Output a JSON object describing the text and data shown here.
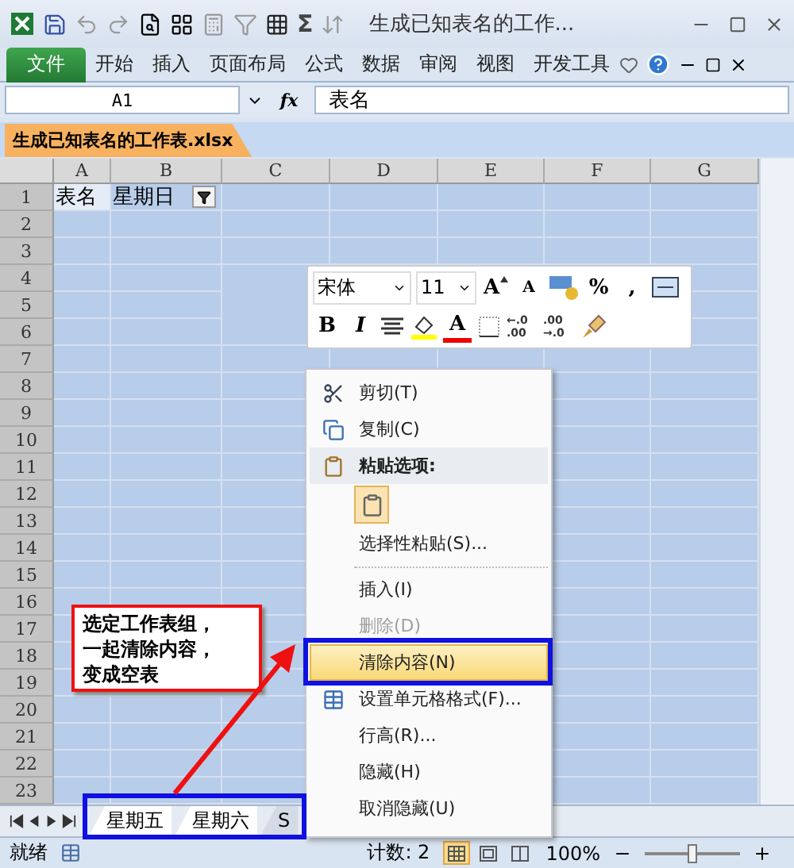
{
  "title_bar": {
    "title": "生成已知表名的工作...",
    "quick_access": [
      {
        "kind": "save"
      },
      {
        "kind": "undo"
      },
      {
        "kind": "redo"
      },
      {
        "kind": "preview"
      },
      {
        "kind": "layout"
      },
      {
        "kind": "calc"
      },
      {
        "kind": "filter"
      },
      {
        "kind": "grid"
      },
      {
        "kind": "text",
        "text": "Σ"
      },
      {
        "kind": "sort"
      }
    ]
  },
  "ribbon": {
    "file": "文件",
    "tabs": [
      "开始",
      "插入",
      "页面布局",
      "公式",
      "数据",
      "审阅",
      "视图",
      "开发工具"
    ]
  },
  "formula_bar": {
    "name_box": "A1",
    "fx": "fx",
    "formula": "表名"
  },
  "workbook_tab": "生成已知表名的工作表.xlsx",
  "columns": [
    "A",
    "B",
    "C",
    "D",
    "E",
    "F",
    "G"
  ],
  "rows": [
    {
      "label": "1",
      "cells": [
        {
          "text": "表名",
          "active": true,
          "filter": false
        },
        {
          "text": "星期日",
          "active": false,
          "filter": true
        }
      ]
    },
    {
      "label": "2"
    },
    {
      "label": "3"
    },
    {
      "label": "4"
    },
    {
      "label": "5"
    },
    {
      "label": "6"
    },
    {
      "label": "7"
    },
    {
      "label": "8"
    },
    {
      "label": "9"
    },
    {
      "label": "10"
    },
    {
      "label": "11"
    },
    {
      "label": "12"
    },
    {
      "label": "13"
    },
    {
      "label": "14"
    },
    {
      "label": "15"
    },
    {
      "label": "16"
    },
    {
      "label": "17"
    },
    {
      "label": "18"
    },
    {
      "label": "19"
    },
    {
      "label": "20"
    },
    {
      "label": "21"
    },
    {
      "label": "22"
    },
    {
      "label": "23"
    }
  ],
  "mini_toolbar": {
    "font": "宋体",
    "size": "11",
    "row_1": [
      {
        "kind": "grow",
        "text": "A"
      },
      {
        "kind": "shrink",
        "text": "A"
      },
      {
        "kind": "accounting"
      },
      {
        "kind": "text",
        "text": "%"
      },
      {
        "kind": "text",
        "text": ","
      },
      {
        "kind": "merge"
      }
    ],
    "row_2": [
      {
        "kind": "bold",
        "text": "B"
      },
      {
        "kind": "italic",
        "text": "I"
      },
      {
        "kind": "align"
      },
      {
        "kind": "fill"
      },
      {
        "kind": "fontcolor",
        "text": "A"
      },
      {
        "kind": "border"
      },
      {
        "kind": "decimal",
        "lines": [
          "←.0",
          ".00"
        ]
      },
      {
        "kind": "decimal",
        "lines": [
          ".00",
          "→.0"
        ]
      },
      {
        "kind": "painter"
      }
    ]
  },
  "context_menu": [
    {
      "kind": "cut",
      "label": "剪切(T)",
      "disabled": false,
      "highlighted": false
    },
    {
      "kind": "copy",
      "label": "复制(C)",
      "disabled": false,
      "highlighted": false
    },
    {
      "kind": "header",
      "label": "粘贴选项:",
      "disabled": false,
      "highlighted": false
    },
    {
      "kind": "paste"
    },
    {
      "kind": "plain",
      "label": "选择性粘贴(S)...",
      "disabled": false,
      "highlighted": false
    },
    {
      "kind": "separator"
    },
    {
      "kind": "plain",
      "label": "插入(I)",
      "disabled": false,
      "highlighted": false
    },
    {
      "kind": "plain",
      "label": "删除(D)",
      "disabled": true,
      "highlighted": false
    },
    {
      "kind": "plain",
      "label": "清除内容(N)",
      "disabled": false,
      "highlighted": true
    },
    {
      "kind": "format",
      "label": "设置单元格格式(F)...",
      "disabled": false,
      "highlighted": false
    },
    {
      "kind": "plain",
      "label": "行高(R)...",
      "disabled": false,
      "highlighted": false
    },
    {
      "kind": "plain",
      "label": "隐藏(H)",
      "disabled": false,
      "highlighted": false
    },
    {
      "kind": "plain",
      "label": "取消隐藏(U)",
      "disabled": false,
      "highlighted": false
    }
  ],
  "callout": [
    "选定工作表组，",
    "一起清除内容，",
    "变成空表"
  ],
  "sheet_tabs": [
    {
      "label": "星期五",
      "selected": true
    },
    {
      "label": "星期六",
      "selected": true
    },
    {
      "label": "S",
      "selected": false
    }
  ],
  "status_bar": {
    "ready": "就绪",
    "count": "计数: 2",
    "views": [
      {
        "kind": "normal",
        "selected": true
      },
      {
        "kind": "page",
        "selected": false
      },
      {
        "kind": "break",
        "selected": false
      }
    ],
    "zoom": "100%",
    "zoom_slider": {
      "level": 0.5
    }
  }
}
